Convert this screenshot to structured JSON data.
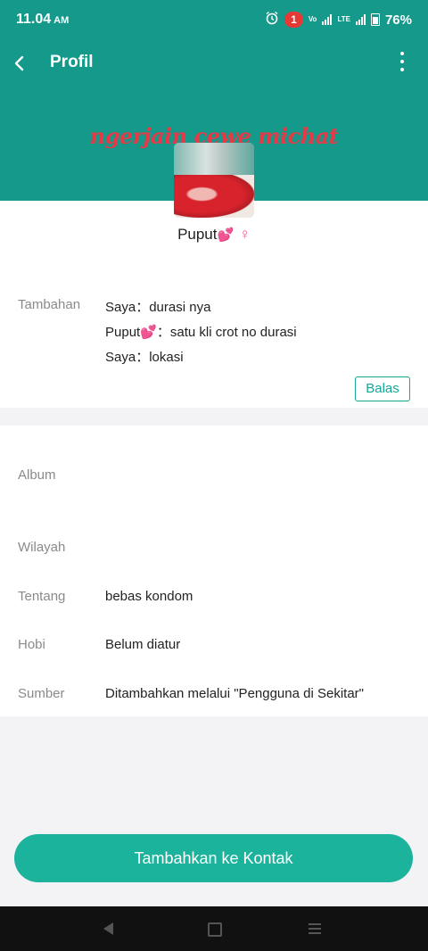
{
  "status_bar": {
    "time": "11.04",
    "ampm": "AM",
    "notification_count": "1",
    "signal_label_1": "Vo",
    "signal_label_2": "LTE",
    "battery": "76%"
  },
  "app_bar": {
    "title": "Profil"
  },
  "overlay_caption": "ngerjain cewe michat",
  "profile": {
    "name": "Puput",
    "name_emoji": "💕",
    "gender_symbol": "♀"
  },
  "greeting": {
    "label": "Tambahan",
    "messages": [
      {
        "sender": "Saya",
        "separator": "：",
        "text": "durasi nya"
      },
      {
        "sender": "Puput💕",
        "separator": "：",
        "text": "satu kli crot no durasi"
      },
      {
        "sender": "Saya",
        "separator": "：",
        "text": "lokasi"
      }
    ],
    "reply_label": "Balas"
  },
  "info": {
    "album_label": "Album",
    "region_label": "Wilayah",
    "region_value": "",
    "about_label": "Tentang",
    "about_value": "bebas kondom",
    "hobby_label": "Hobi",
    "hobby_value": "Belum diatur",
    "source_label": "Sumber",
    "source_value": "Ditambahkan melalui \"Pengguna di Sekitar\""
  },
  "actions": {
    "add_contact_label": "Tambahkan ke Kontak"
  },
  "colors": {
    "header_green": "#15998b",
    "accent": "#1bb39b",
    "label_gray": "#8a8a8a"
  }
}
